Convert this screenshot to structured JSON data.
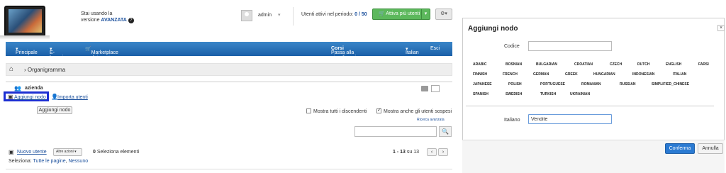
{
  "header": {
    "version_line1": "Stai usando la",
    "version_prefix": "versione",
    "version_name": "AVANZATA",
    "help_icon": "?",
    "username": "admin",
    "active_users_label": "Utenti attivi nel periodo:",
    "active_users_value": "0 / 50",
    "buy_users_label": "Attiva più utenti"
  },
  "nav": {
    "items": [
      "Principale",
      "E-Learning",
      "Marketplace dei corsi"
    ],
    "switch_label": "Passa alla visualizzazione",
    "switch_target": "Corsi",
    "language": "Italian",
    "logout": "Esci"
  },
  "breadcrumb": {
    "current": "Organigramma"
  },
  "tree": {
    "root": "azienda",
    "add_node": "Aggiungi nodo",
    "import_users": "Importa utenti",
    "tooltip": "Aggiungi nodo"
  },
  "filters": {
    "show_descendants": "Mostra tutti i discendenti",
    "show_suspended": "Mostra anche gli utenti sospesi",
    "advanced_search": "Ricerca avanzata"
  },
  "users": {
    "new_user": "Nuovo utente",
    "other_actions": "Altre azioni",
    "selected_count": "0",
    "selected_label": "Seleziona elementi",
    "range": "1 - 13",
    "of_label": "su 13",
    "select_label": "Seleziona:",
    "all_pages": "Tutte le pagine",
    "none": "Nessuno"
  },
  "modal": {
    "title": "Aggiungi nodo",
    "code_label": "Codice",
    "code_value": "",
    "languages": [
      [
        "ARABIC",
        "BOSNIAN",
        "BULGARIAN",
        "CROATIAN",
        "CZECH",
        "DUTCH",
        "ENGLISH",
        "FARSI"
      ],
      [
        "FINNISH",
        "FRENCH",
        "GERMAN",
        "GREEK",
        "HUNGARIAN",
        "INDONESIAN",
        "ITALIAN"
      ],
      [
        "JAPANESE",
        "POLISH",
        "PORTUGUESE",
        "ROMANIAN",
        "RUSSIAN",
        "SIMPLIFIED_CHINESE"
      ],
      [
        "SPANISH",
        "SWEDISH",
        "TURKISH",
        "UKRAINIAN"
      ]
    ],
    "italian_label": "Italiano",
    "italian_value": "Vendite",
    "confirm": "Conferma",
    "cancel": "Annulla"
  }
}
